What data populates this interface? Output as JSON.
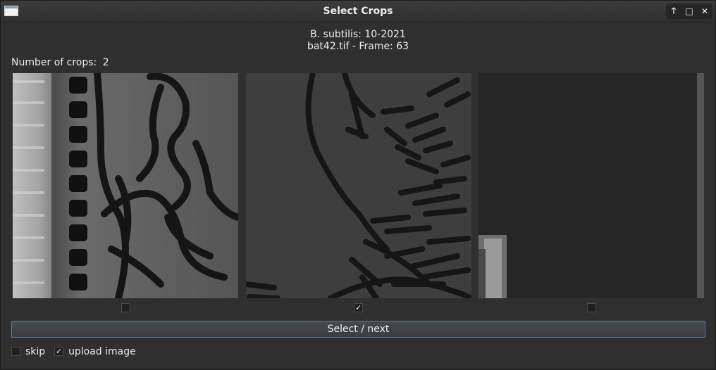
{
  "window": {
    "title": "Select Crops",
    "buttons": {
      "shade": "🡑",
      "maximize": "□",
      "close": "✕"
    }
  },
  "header": {
    "line1": "B. subtilis: 10-2021",
    "line2": "bat42.tif - Frame: 63"
  },
  "crop_count": {
    "label": "Number of crops:",
    "value": "2"
  },
  "crops": [
    {
      "checked": false,
      "mark": ""
    },
    {
      "checked": true,
      "mark": "✓"
    },
    {
      "checked": false,
      "mark": ""
    }
  ],
  "actions": {
    "select_next": "Select / next"
  },
  "options": {
    "skip": {
      "label": "skip",
      "checked": false,
      "mark": ""
    },
    "upload": {
      "label": "upload image",
      "checked": true,
      "mark": "✓"
    }
  },
  "colors": {
    "accent_border": "#5b7ea8",
    "background": "#2f2f2f"
  }
}
